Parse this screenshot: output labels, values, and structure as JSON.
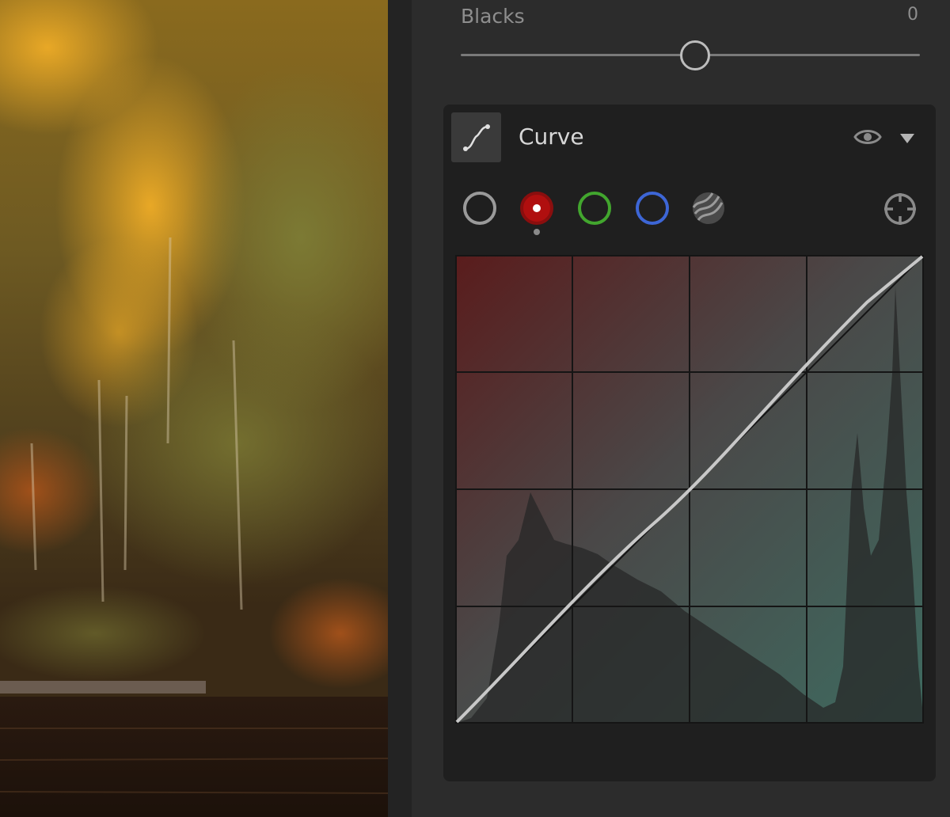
{
  "blacks": {
    "label": "Blacks",
    "value": "0",
    "slider_position": 0.51
  },
  "curve": {
    "title": "Curve",
    "active_channel": "red",
    "channels": [
      {
        "name": "luminance",
        "color": "#9a9a9a"
      },
      {
        "name": "red",
        "color": "#b00f0f"
      },
      {
        "name": "green",
        "color": "#42a62e"
      },
      {
        "name": "blue",
        "color": "#3d66d6"
      },
      {
        "name": "saturation",
        "color": "#7a7a7a"
      }
    ],
    "icons": [
      "curve-icon",
      "eye-icon",
      "chevron-down-icon",
      "target-icon"
    ],
    "curve_points": [
      [
        0,
        0
      ],
      [
        0.25,
        0.26
      ],
      [
        0.5,
        0.56
      ],
      [
        0.75,
        0.78
      ],
      [
        1,
        1
      ]
    ],
    "colors": {
      "red_tint": "#5a1c1c",
      "cyan_tint": "#3e6b60"
    }
  }
}
